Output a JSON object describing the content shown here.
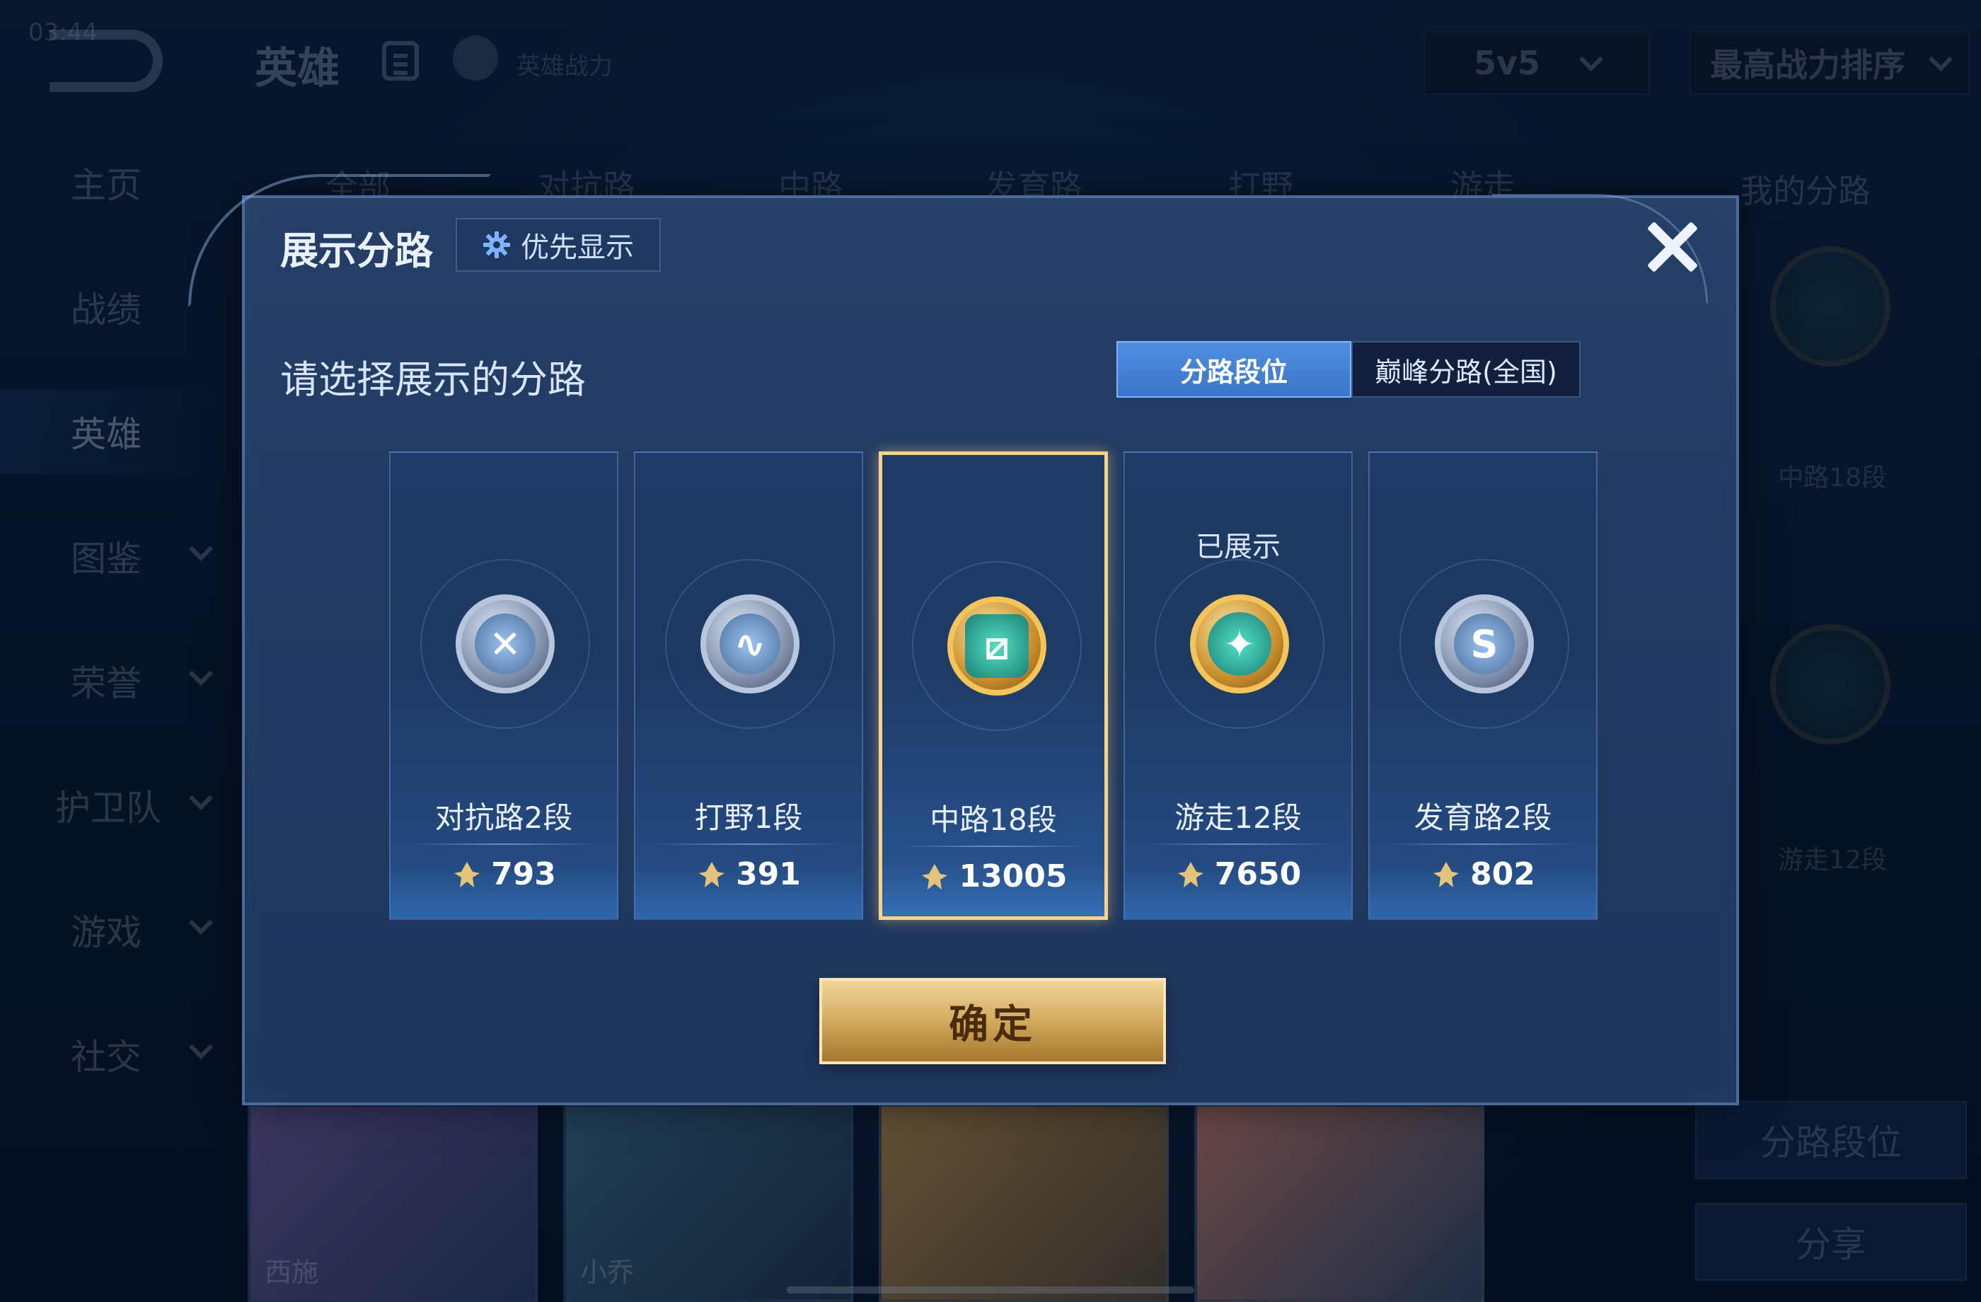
{
  "status": {
    "time": "03:44"
  },
  "topbar": {
    "title": "英雄",
    "power_label": "英雄战力",
    "mode": "5v5",
    "sort": "最高战力排序"
  },
  "sidebar": {
    "items": [
      {
        "label": "主页"
      },
      {
        "label": "战绩"
      },
      {
        "label": "英雄"
      },
      {
        "label": "图鉴"
      },
      {
        "label": "荣誉"
      },
      {
        "label": "护卫队"
      },
      {
        "label": "游戏"
      },
      {
        "label": "社交"
      }
    ]
  },
  "bg_tabs": [
    "全部",
    "对抗路",
    "中路",
    "发育路",
    "打野",
    "游走"
  ],
  "right_panel": {
    "title": "我的分路",
    "lane1": "中路18段",
    "lane2": "游走12段",
    "btn_rank": "分路段位",
    "btn_share": "分享"
  },
  "heroes": [
    "西施",
    "小乔"
  ],
  "modal": {
    "title": "展示分路",
    "priority_label": "优先显示",
    "subtitle": "请选择展示的分路",
    "segment": {
      "selected": "分路段位",
      "other": "巅峰分路(全国)"
    },
    "shown_label": "已展示",
    "lanes": [
      {
        "name": "对抗路2段",
        "points": "793",
        "icon": "sword-medal-icon",
        "style": "silver"
      },
      {
        "name": "打野1段",
        "points": "391",
        "icon": "dragon-medal-icon",
        "style": "silver"
      },
      {
        "name": "中路18段",
        "points": "13005",
        "icon": "slash-medal-icon",
        "style": "gold"
      },
      {
        "name": "游走12段",
        "points": "7650",
        "icon": "wings-medal-icon",
        "style": "gold"
      },
      {
        "name": "发育路2段",
        "points": "802",
        "icon": "arrow-medal-icon",
        "style": "silver"
      }
    ],
    "confirm": "确定"
  },
  "colors": {
    "accent": "#4f8ee0",
    "gold": "#d1aa5e",
    "selected_border": "#f6d48a"
  }
}
